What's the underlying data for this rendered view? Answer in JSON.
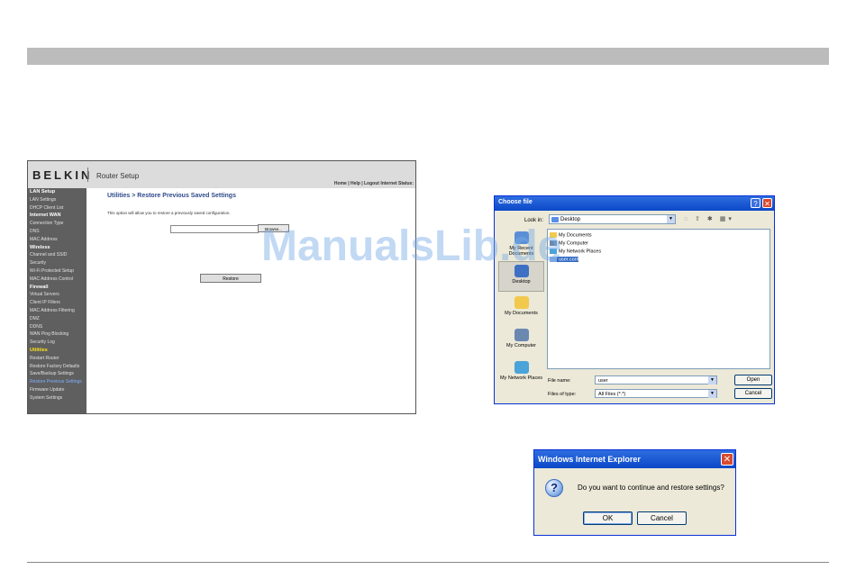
{
  "router": {
    "logo": "BELKIN",
    "title": "Router Setup",
    "top_links": "Home | Help | Logout  Internet Status:",
    "sidebar": [
      {
        "label": "LAN Setup",
        "kind": "head"
      },
      {
        "label": "LAN Settings",
        "kind": "item"
      },
      {
        "label": "DHCP Client List",
        "kind": "item"
      },
      {
        "label": "Internet WAN",
        "kind": "head"
      },
      {
        "label": "Connection Type",
        "kind": "item"
      },
      {
        "label": "DNS",
        "kind": "item"
      },
      {
        "label": "MAC Address",
        "kind": "item"
      },
      {
        "label": "Wireless",
        "kind": "head"
      },
      {
        "label": "Channel and SSID",
        "kind": "item"
      },
      {
        "label": "Security",
        "kind": "item"
      },
      {
        "label": "Wi-Fi Protected Setup",
        "kind": "item"
      },
      {
        "label": "MAC Address Control",
        "kind": "item"
      },
      {
        "label": "Firewall",
        "kind": "head"
      },
      {
        "label": "Virtual Servers",
        "kind": "item"
      },
      {
        "label": "Client IP Filters",
        "kind": "item"
      },
      {
        "label": "MAC Address Filtering",
        "kind": "item"
      },
      {
        "label": "DMZ",
        "kind": "item"
      },
      {
        "label": "DDNS",
        "kind": "item"
      },
      {
        "label": "WAN Ping Blocking",
        "kind": "item"
      },
      {
        "label": "Security Log",
        "kind": "item"
      },
      {
        "label": "Utilities",
        "kind": "head-hl"
      },
      {
        "label": "Restart Router",
        "kind": "item"
      },
      {
        "label": "Restore Factory Defaults",
        "kind": "item"
      },
      {
        "label": "Save/Backup Settings",
        "kind": "item"
      },
      {
        "label": "Restore Previous Settings",
        "kind": "active"
      },
      {
        "label": "Firmware Update",
        "kind": "item"
      },
      {
        "label": "System Settings",
        "kind": "item"
      }
    ],
    "heading": "Utilities > Restore Previous Saved Settings",
    "description": "This option will allow you to restore a previously saved configuration.",
    "file_value": "",
    "browse_label": "Browse...",
    "restore_label": "Restore"
  },
  "choose_file": {
    "title": "Choose file",
    "help_glyph": "?",
    "close_glyph": "✕",
    "look_in_label": "Look in:",
    "look_in_value": "Desktop",
    "toolbar_icons": "◌ ⇧ ✱ ▦▾",
    "places": [
      {
        "label": "My Recent Documents",
        "icon": "recent-documents-icon"
      },
      {
        "label": "Desktop",
        "icon": "desktop-icon",
        "selected": true
      },
      {
        "label": "My Documents",
        "icon": "my-documents-icon"
      },
      {
        "label": "My Computer",
        "icon": "my-computer-icon"
      },
      {
        "label": "My Network Places",
        "icon": "network-places-icon"
      }
    ],
    "files": [
      {
        "label": "My Documents",
        "icon": "folder-icon"
      },
      {
        "label": "My Computer",
        "icon": "computer-icon"
      },
      {
        "label": "My Network Places",
        "icon": "network-icon"
      },
      {
        "label": "user.conf",
        "icon": "file-icon",
        "selected": true
      }
    ],
    "file_name_label": "File name:",
    "file_name_value": "user",
    "file_type_label": "Files of type:",
    "file_type_value": "All Files (*.*)",
    "open_label": "Open",
    "cancel_label": "Cancel"
  },
  "watermark": "ManualsLib.de",
  "ie_dialog": {
    "title": "Windows Internet Explorer",
    "close_glyph": "✕",
    "question_glyph": "?",
    "message": "Do you want to continue and restore settings?",
    "ok_label": "OK",
    "cancel_label": "Cancel"
  }
}
